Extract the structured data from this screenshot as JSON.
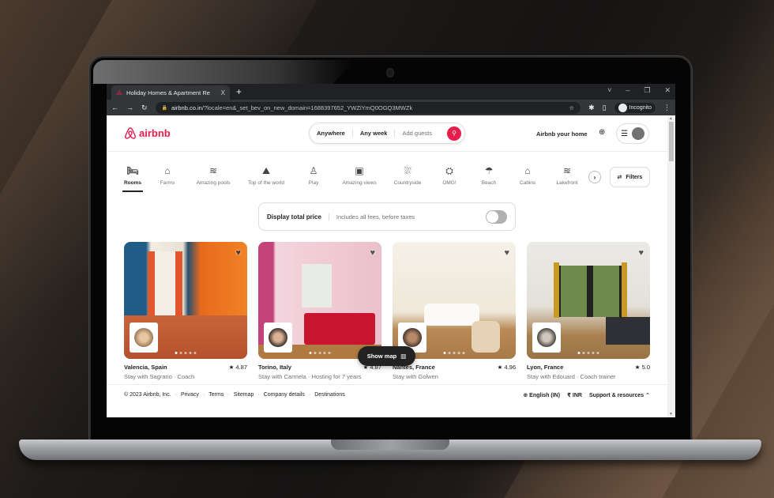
{
  "browser": {
    "tab_title": "Holiday Homes & Apartment Re",
    "tab_close": "X",
    "new_tab": "+",
    "window_controls": [
      "˅",
      "–",
      "❐",
      "✕"
    ],
    "url_domain": "airbnb.co.in",
    "url_path": "/?locale=en&_set_bev_on_new_domain=1688397652_YWZiYmQ0OGQ3MWZk",
    "profile_label": "Incognito",
    "nav": {
      "back": "←",
      "forward": "→",
      "reload": "↻",
      "lock": "🔒",
      "star": "☆",
      "extensions": "✱",
      "sidepanel": "▯",
      "menu": "⋮"
    }
  },
  "header": {
    "logo_text": "airbnb",
    "brand_color": "#e61e4d",
    "search": {
      "where": "Anywhere",
      "when": "Any week",
      "who": "Add guests"
    },
    "host_link": "Airbnb your home",
    "globe_icon": "⊕",
    "menu_icon": "☰"
  },
  "categories": {
    "items": [
      {
        "label": "Rooms",
        "icon": "bed-icon",
        "glyph": "🛏",
        "active": true
      },
      {
        "label": "Farms",
        "icon": "farm-icon",
        "glyph": "⌂",
        "active": false
      },
      {
        "label": "Amazing pools",
        "icon": "pool-icon",
        "glyph": "≋",
        "active": false
      },
      {
        "label": "Top of the world",
        "icon": "mountain-flag-icon",
        "glyph": "⛰",
        "active": false
      },
      {
        "label": "Play",
        "icon": "bowling-icon",
        "glyph": "♙",
        "active": false
      },
      {
        "label": "Amazing views",
        "icon": "views-icon",
        "glyph": "▣",
        "active": false
      },
      {
        "label": "Countryside",
        "icon": "countryside-icon",
        "glyph": "⛆",
        "active": false
      },
      {
        "label": "OMG!",
        "icon": "ufo-icon",
        "glyph": "⛭",
        "active": false
      },
      {
        "label": "Beach",
        "icon": "umbrella-icon",
        "glyph": "☂",
        "active": false
      },
      {
        "label": "Cabins",
        "icon": "cabin-icon",
        "glyph": "⌂",
        "active": false
      },
      {
        "label": "Lakefront",
        "icon": "lakefront-icon",
        "glyph": "≋",
        "active": false
      }
    ],
    "next_glyph": "›",
    "filters_label": "Filters",
    "filters_glyph": "⇄"
  },
  "price_toggle": {
    "label": "Display total price",
    "description": "Includes all fees, before taxes",
    "enabled": false
  },
  "listings": [
    {
      "location": "Valencia, Spain",
      "rating": "★ 4.87",
      "subtitle": "Stay with Sagrario · Coach"
    },
    {
      "location": "Torino, Italy",
      "rating": "★ 4.87",
      "subtitle": "Stay with Carmela · Hosting for 7 years"
    },
    {
      "location": "Nantes, France",
      "rating": "★ 4.96",
      "subtitle": "Stay with Golwen"
    },
    {
      "location": "Lyon, France",
      "rating": "★ 5.0",
      "subtitle": "Stay with Edouard · Coach trainer"
    }
  ],
  "show_map": {
    "label": "Show map",
    "glyph": "▥"
  },
  "footer": {
    "copyright": "© 2023 Airbnb, Inc.",
    "links": [
      "Privacy",
      "Terms",
      "Sitemap",
      "Company details",
      "Destinations"
    ],
    "separator": "·",
    "language": "English (IN)",
    "currency": "₹  INR",
    "support": "Support & resources ⌃",
    "globe_glyph": "⊕"
  }
}
